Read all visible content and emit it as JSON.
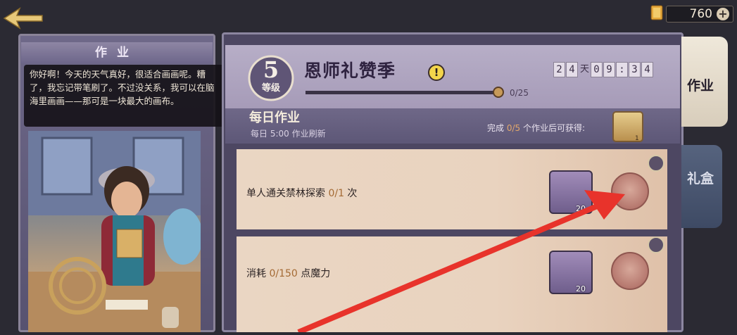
{
  "top_bar": {
    "currency_value": "760",
    "back_icon": "back-arrow-icon",
    "currency_icon": "gold-card-icon",
    "add_icon": "plus-icon"
  },
  "left_panel": {
    "title": "作业",
    "speech": "你好啊！今天的天气真好，很适合画画呢。糟了，我忘记带笔刷了。不过没关系，我可以在脑海里画画——那可是一块最大的画布。"
  },
  "season": {
    "level": "5",
    "level_label": "等级",
    "title": "恩师礼赞季",
    "progress_text": "0/25",
    "progress_fraction": 0.0,
    "timer": {
      "days": [
        "2",
        "4"
      ],
      "day_unit": "天",
      "time": [
        "0",
        "9",
        ":",
        "3",
        "4"
      ]
    }
  },
  "daily": {
    "title": "每日作业",
    "refresh": "每日 5:00 作业刷新",
    "reward_prefix": "完成 ",
    "reward_progress": "0/5",
    "reward_suffix": " 个作业后可获得:",
    "reward_count": "1"
  },
  "tasks": [
    {
      "label_pre": "单人通关禁林探索 ",
      "progress": "0/1",
      "label_post": " 次",
      "reward_count": "20"
    },
    {
      "label_pre": "消耗 ",
      "progress": "0/150",
      "label_post": " 点魔力",
      "reward_count": "20"
    }
  ],
  "tabs": {
    "homework": "作业",
    "gift": "礼盒"
  },
  "colors": {
    "accent_red_arrow": "#e8332b",
    "progress_highlight": "#a46a34"
  }
}
